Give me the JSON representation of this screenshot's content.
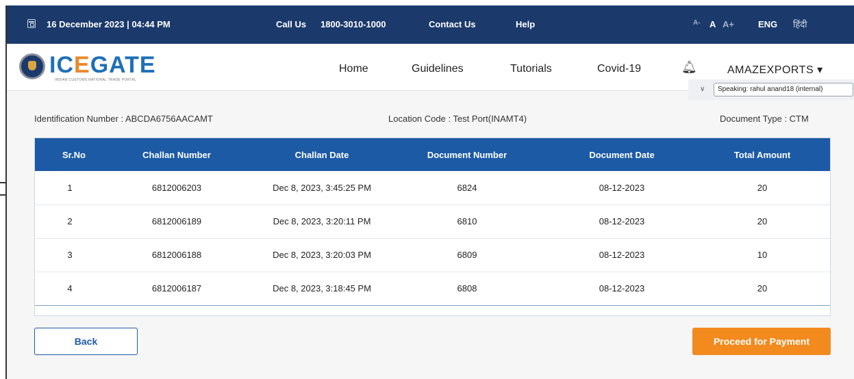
{
  "topbar": {
    "datetime": "16 December 2023 | 04:44 PM",
    "call_label": "Call Us",
    "phone": "1800-3010-1000",
    "contact": "Contact Us",
    "help": "Help",
    "font_small": "A-",
    "font_normal": "A",
    "font_large": "A+",
    "lang_eng": "ENG",
    "lang_hindi": "हिंदी"
  },
  "header": {
    "logo_text_1": "IC",
    "logo_text_2": "E",
    "logo_text_3": "GATE",
    "logo_sub": "INDIAN CUSTOMS NATIONAL TRADE PORTAL",
    "nav": [
      "Home",
      "Guidelines",
      "Tutorials",
      "Covid-19"
    ],
    "user": "AMAZEXPORTS",
    "user_caret": "▾",
    "speaking": "Speaking: rahul anand18 (internal)"
  },
  "info": {
    "identification": "Identification Number : ABCDA6756AACAMT",
    "location": "Location Code : Test Port(INAMT4)",
    "doc_type": "Document Type : CTM"
  },
  "table": {
    "headers": [
      "Sr.No",
      "Challan Number",
      "Challan Date",
      "Document Number",
      "Document Date",
      "Total Amount"
    ],
    "rows": [
      [
        "1",
        "6812006203",
        "Dec 8, 2023, 3:45:25 PM",
        "6824",
        "08-12-2023",
        "20"
      ],
      [
        "2",
        "6812006189",
        "Dec 8, 2023, 3:20:11 PM",
        "6810",
        "08-12-2023",
        "20"
      ],
      [
        "3",
        "6812006188",
        "Dec 8, 2023, 3:20:03 PM",
        "6809",
        "08-12-2023",
        "10"
      ],
      [
        "4",
        "6812006187",
        "Dec 8, 2023, 3:18:45 PM",
        "6808",
        "08-12-2023",
        "20"
      ]
    ]
  },
  "buttons": {
    "back": "Back",
    "proceed": "Proceed for Payment"
  },
  "colors": {
    "topbar": "#1b3a6b",
    "table_header": "#1c5aa6",
    "accent_orange": "#f28a1e"
  }
}
